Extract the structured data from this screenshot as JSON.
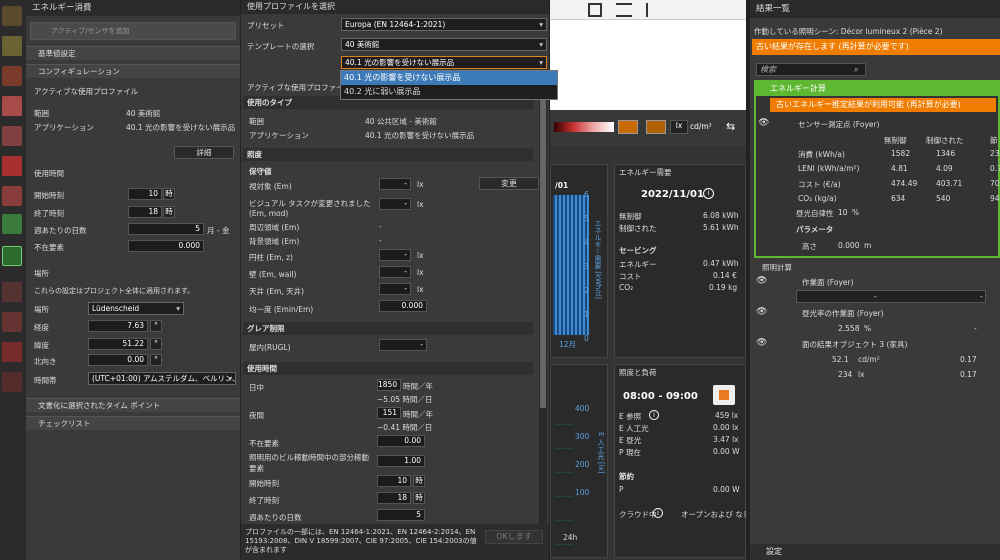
{
  "left": {
    "title": "エネルギー消費",
    "add_sensor": "アクティブ/センサを追加",
    "sec_base": "基準値設定",
    "sec_config": "コンフィギュレーション",
    "active_profile": "アクティブな使用プロファイル",
    "range_lbl": "範囲",
    "range_val": "40 美術館",
    "app_lbl": "アプリケーション",
    "app_val": "40.1 光の影響を受けない展示品",
    "detail_btn": "詳細",
    "usage_time": "使用時間",
    "start_lbl": "開始時刻",
    "start_val": "10",
    "end_lbl": "終了時刻",
    "end_val": "18",
    "hour_unit": "時",
    "days_lbl": "週あたりの日数",
    "days_val": "5",
    "days_unit": "月 - 金",
    "absent_lbl": "不在要素",
    "absent_val": "0.000",
    "place": "場所",
    "place_note": "これらの設定はプロジェクト全体に適用されます。",
    "loc_lbl": "場所",
    "loc_val": "Lüdenscheid",
    "lon_lbl": "経度",
    "lon_val": "7.63",
    "lat_lbl": "緯度",
    "lat_val": "51.22",
    "north_lbl": "北向き",
    "north_val": "0.00",
    "deg": "°",
    "tz_lbl": "時間帯",
    "tz_val": "(UTC+01:00) アムステルダム、ベルリン、^",
    "sec_doc": "文書化に選択されたタイム ポイント",
    "sec_check": "チェックリスト"
  },
  "mid": {
    "title": "使用プロファイルを選択",
    "preset_lbl": "プリセット",
    "preset_val": "Europa (EN 12464-1:2021)",
    "tpl_lbl": "テンプレートの選択",
    "tpl_val": "40 美術館",
    "sel_val": "40.1 光の影響を受けない展示品",
    "opt1": "40.1 光の影響を受けない展示品",
    "opt2": "40.2 光に弱い展示品",
    "active": "アクティブな使用プロファイル",
    "type_sec": "使用のタイプ",
    "range_lbl": "範囲",
    "range_val": "40 公共区域 - 美術館",
    "app_lbl": "アプリケーション",
    "app_val": "40.1 光の影響を受けない展示品",
    "illum_sec": "照度",
    "maint": "保守値",
    "em_lbl": "視対象 (Em)",
    "change_btn": "変更",
    "visual_lbl": "ビジュアル タスクが変更されました (Em, mod)",
    "surround_lbl": "周辺領域 (Em)",
    "bg_lbl": "背景領域 (Em)",
    "cyl_lbl": "円柱 (Em, z)",
    "wall_lbl": "壁 (Em, wall)",
    "ceil_lbl": "天井 (Em, 天井)",
    "unif_lbl": "均一度 (Emin/Em)",
    "unif_val": "0.000",
    "dash": "-",
    "lx": "lx",
    "glare_sec": "グレア制限",
    "rugl_lbl": "屋内(RUGL)",
    "use_sec": "使用時間",
    "day_lbl": "日中",
    "day_val": "1850",
    "day_unit": "時間／年",
    "day_sub": "~5.05 時間／日",
    "night_lbl": "夜間",
    "night_val": "151",
    "night_unit": "時間／年",
    "night_sub": "~0.41 時間／日",
    "absent_lbl": "不在要素",
    "absent_val": "0.00",
    "part_lbl": "照明用のビル稼動時間中の部分稼動要素",
    "part_val": "1.00",
    "start_lbl": "開始時刻",
    "start_val": "10",
    "end_lbl": "終了時刻",
    "end_val": "18",
    "hour": "時",
    "days_lbl": "週あたりの日数",
    "days_val": "5",
    "footer": "プロファイルの一部には、EN 12464-1:2021、EN 12464-2:2014、EN 15193:2008、DIN V 18599:2007、CIE 97:2005、CIE 154:2003の値が含まれます",
    "ok_btn": "OKします"
  },
  "center": {
    "lum_unit": "lx",
    "cd": "cd/m²",
    "energy_title": "エネルギー需要",
    "date": "2022/11/01",
    "info": "i",
    "noctrl_lbl": "無制御",
    "noctrl_val": "6.08 kWh",
    "ctrl_lbl": "制御された",
    "ctrl_val": "5.61 kWh",
    "saving": "セービング",
    "en_lbl": "エネルギー",
    "en_val": "0.47 kWh",
    "cost_lbl": "コスト",
    "cost_val": "0.14 €",
    "co2_lbl": "CO₂",
    "co2_val": "0.19 kg",
    "chart_head": "/01",
    "axis_e": "エネルギー需要 [kWh/d]",
    "month": "12月",
    "load_title": "照度と負荷",
    "time": "08:00 - 09:00",
    "eref_lbl": "E 参照",
    "eref_val": "459 lx",
    "eart_lbl": "E 人工光",
    "eart_val": "0.00 lx",
    "eday_lbl": "E 昼光",
    "eday_val": "3.47 lx",
    "pnow_lbl": "P 現在",
    "pnow_val": "0.00 W",
    "save2": "節約",
    "p_lbl": "P",
    "p_val": "0.00 W",
    "cloud_lbl": "クラウド中",
    "cloud_val": "オープンおよび なし",
    "axis_lx": "E 人工光 [lx]",
    "h24": "24h",
    "ticks_e": [
      "6",
      "5",
      "4",
      "3",
      "2",
      "1",
      "0"
    ],
    "ticks_lx": [
      "400",
      "300",
      "200",
      "100"
    ]
  },
  "right": {
    "title": "結果一覧",
    "scene": "作動している照明シーン: Décor lumineux 2 (Pièce 2)",
    "warn": "古い結果が存在します (再計算が必要です)",
    "search": "検索",
    "energy": "エネルギー計算",
    "warn2": "古いエネルギー推定結果が利用可能 (再計算が必要)",
    "sensor": "センサー測定点 (Foyer)",
    "col1": "無制御",
    "col2": "制御された",
    "col3": "節",
    "rows": [
      {
        "l": "消費 (kWh/a)",
        "a": "1582",
        "b": "1346",
        "c": "23"
      },
      {
        "l": "LENI (kWh/a/m²)",
        "a": "4.81",
        "b": "4.09",
        "c": "0.7"
      },
      {
        "l": "コスト (€/a)",
        "a": "474.49",
        "b": "403.71",
        "c": "70.7"
      },
      {
        "l": "CO₂ (kg/a)",
        "a": "634",
        "b": "540",
        "c": "94."
      }
    ],
    "dayauto_lbl": "昼光自律性",
    "dayauto_val": "10",
    "pct": "%",
    "param": "パラメータ",
    "height_lbl": "高さ",
    "height_val": "0.000",
    "m": "m",
    "light_calc": "照明計算",
    "work": "作業面 (Foyer)",
    "dash": "-",
    "daylight": "昼光率の作業面 (Foyer)",
    "df_val": "2.558",
    "obj": "面の結果オブジェクト 3 (家具)",
    "lum_val": "52.1",
    "lum_unit": "cd/m²",
    "lum_r": "0.17",
    "ill_val": "234",
    "ill_unit": "lx",
    "ill_r": "0.17",
    "settings": "設定"
  },
  "colors": {
    "orange": "#f07c00",
    "green": "#5fb832",
    "accent": "#3d7ab8"
  }
}
